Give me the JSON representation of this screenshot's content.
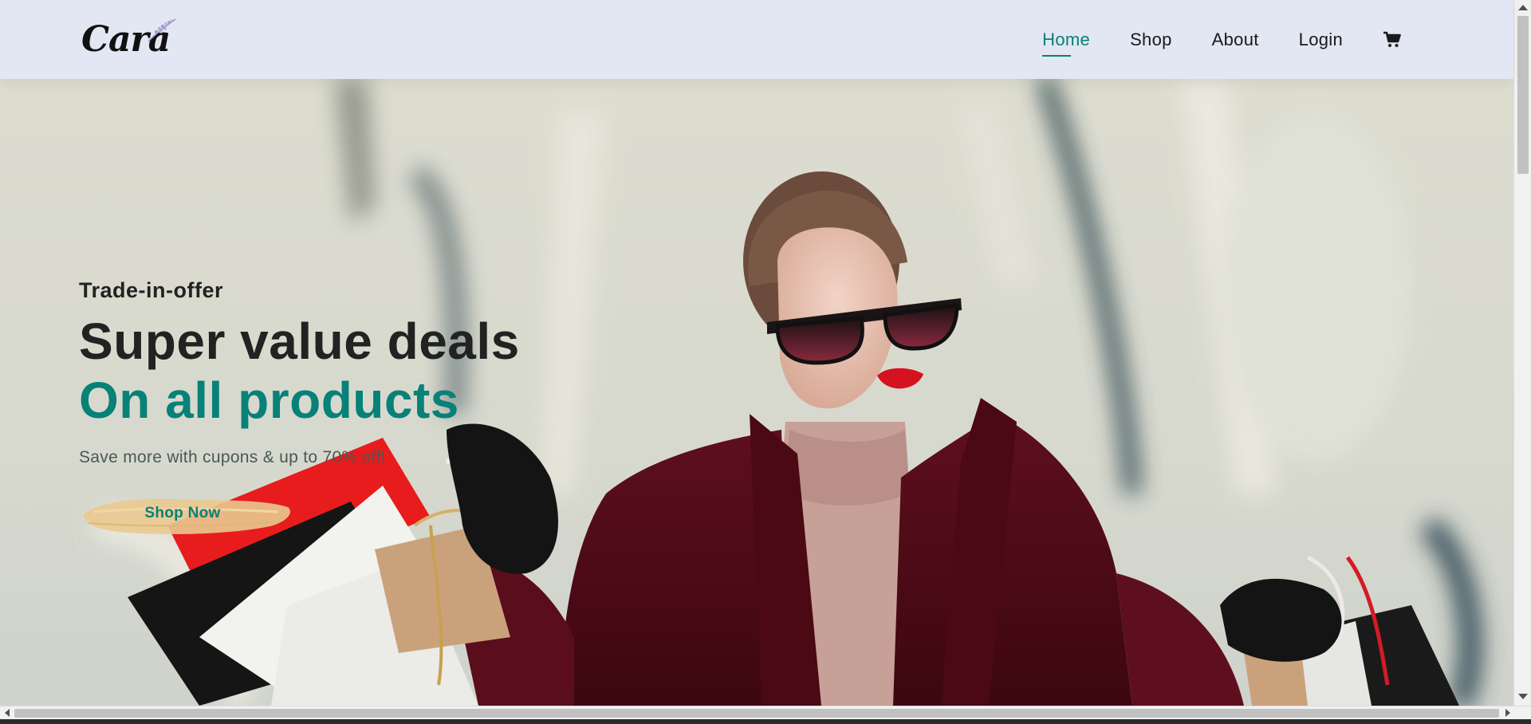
{
  "header": {
    "logo_text": "Cara",
    "nav": [
      {
        "label": "Home",
        "active": true
      },
      {
        "label": "Shop",
        "active": false
      },
      {
        "label": "About",
        "active": false
      },
      {
        "label": "Login",
        "active": false
      }
    ],
    "cart_icon": "shopping-cart-icon"
  },
  "hero": {
    "eyebrow": "Trade-in-offer",
    "title": "Super value deals",
    "title_accent": "On all products",
    "subtitle": "Save more with cupons & up to 70% off!",
    "button_label": "Shop Now"
  },
  "colors": {
    "accent": "#088178",
    "header_bg": "#e3e6f3",
    "text_dark": "#222222",
    "button_brush": "#e9c98f"
  }
}
